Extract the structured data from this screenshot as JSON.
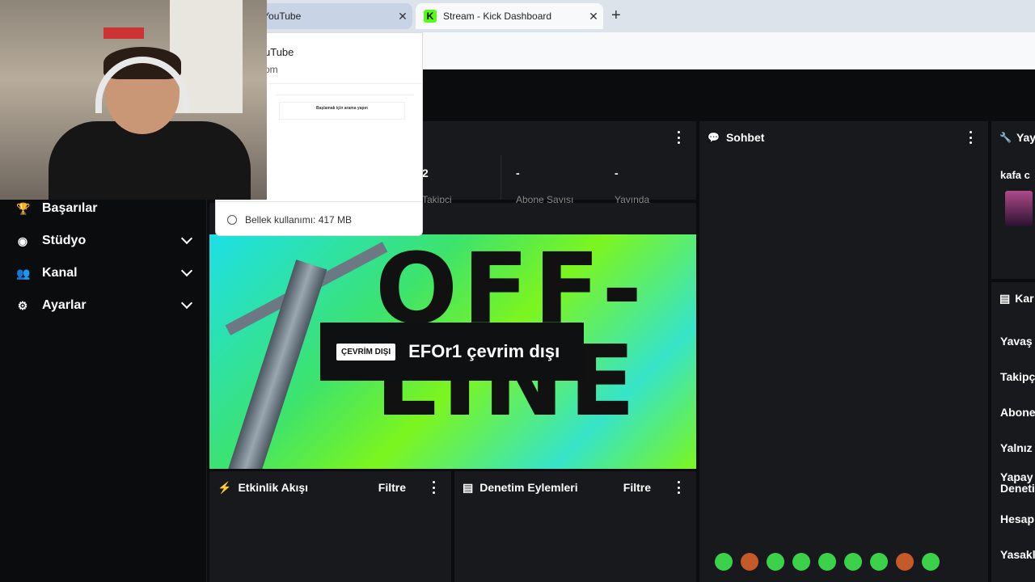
{
  "browser": {
    "tabs": [
      {
        "title": ") YouTube",
        "active": false
      },
      {
        "title": "Stream - Kick Dashboard",
        "active": true
      }
    ],
    "close_glyph": "✕",
    "new_tab_glyph": "+",
    "kick_favicon_letter": "K"
  },
  "tab_preview": {
    "title": "uTube",
    "url": "om",
    "thumb_text": "Başlamak için arama yapın",
    "memory": "Bellek kullanımı: 417 MB"
  },
  "sidebar": {
    "items": [
      {
        "label": "Başarılar",
        "icon": "trophy-icon",
        "glyph": "🏆",
        "expandable": false
      },
      {
        "label": "Stüdyo",
        "icon": "studio-icon",
        "glyph": "◉",
        "expandable": true
      },
      {
        "label": "Kanal",
        "icon": "channel-icon",
        "glyph": "👥",
        "expandable": true
      },
      {
        "label": "Ayarlar",
        "icon": "gear-icon",
        "glyph": "⚙",
        "expandable": true
      }
    ]
  },
  "stats": {
    "values": [
      "2",
      "-",
      "-"
    ],
    "labels": [
      "Takipçi",
      "Abone Sayısı",
      "Yayında"
    ]
  },
  "stream": {
    "offline_art_text": "OFF-\nLINE",
    "badge": "ÇEVRİM DIŞI",
    "message": "EFOr1 çevrim dışı"
  },
  "panels": {
    "chat": {
      "title": "Sohbet",
      "icon_glyph": "💬"
    },
    "activity": {
      "title": "Etkinlik Akışı",
      "filter": "Filtre",
      "icon_glyph": "⚡"
    },
    "moderation": {
      "title": "Denetim Eylemleri",
      "filter": "Filtre",
      "icon_glyph": "▤"
    },
    "broadcast": {
      "title": "Yay",
      "icon_glyph": "🔧",
      "name": "kafa c"
    },
    "chat_settings": {
      "title": "Kar",
      "icon_glyph": "▤",
      "items": [
        "Yavaş",
        "Takipç",
        "Abone",
        "Yalnız",
        "Yapay\nDeneti",
        "Hesap",
        "Yasakl"
      ]
    }
  },
  "colors": {
    "accent": "#53fc18",
    "panel": "#18191c",
    "background": "#0b0c0d"
  }
}
